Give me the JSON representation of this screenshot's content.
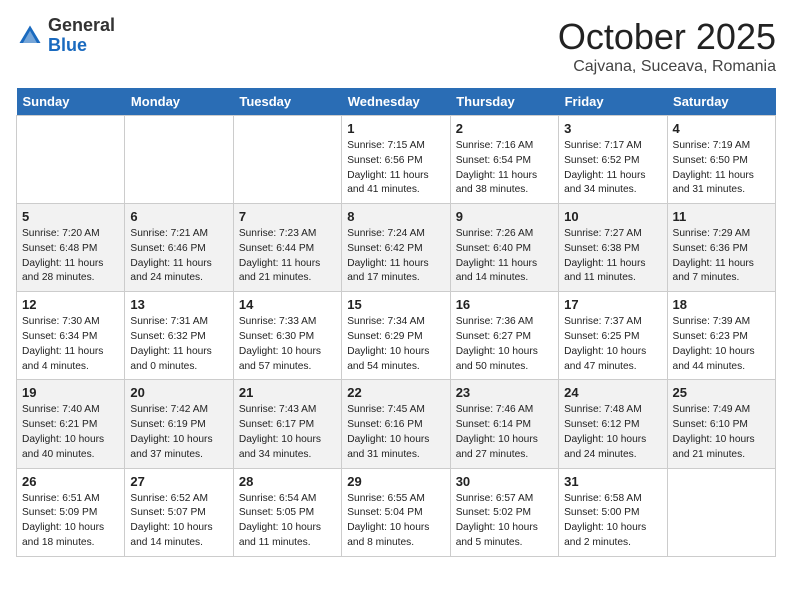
{
  "header": {
    "logo_general": "General",
    "logo_blue": "Blue",
    "month": "October 2025",
    "location": "Cajvana, Suceava, Romania"
  },
  "days_of_week": [
    "Sunday",
    "Monday",
    "Tuesday",
    "Wednesday",
    "Thursday",
    "Friday",
    "Saturday"
  ],
  "weeks": [
    [
      {
        "day": "",
        "info": ""
      },
      {
        "day": "",
        "info": ""
      },
      {
        "day": "",
        "info": ""
      },
      {
        "day": "1",
        "info": "Sunrise: 7:15 AM\nSunset: 6:56 PM\nDaylight: 11 hours\nand 41 minutes."
      },
      {
        "day": "2",
        "info": "Sunrise: 7:16 AM\nSunset: 6:54 PM\nDaylight: 11 hours\nand 38 minutes."
      },
      {
        "day": "3",
        "info": "Sunrise: 7:17 AM\nSunset: 6:52 PM\nDaylight: 11 hours\nand 34 minutes."
      },
      {
        "day": "4",
        "info": "Sunrise: 7:19 AM\nSunset: 6:50 PM\nDaylight: 11 hours\nand 31 minutes."
      }
    ],
    [
      {
        "day": "5",
        "info": "Sunrise: 7:20 AM\nSunset: 6:48 PM\nDaylight: 11 hours\nand 28 minutes."
      },
      {
        "day": "6",
        "info": "Sunrise: 7:21 AM\nSunset: 6:46 PM\nDaylight: 11 hours\nand 24 minutes."
      },
      {
        "day": "7",
        "info": "Sunrise: 7:23 AM\nSunset: 6:44 PM\nDaylight: 11 hours\nand 21 minutes."
      },
      {
        "day": "8",
        "info": "Sunrise: 7:24 AM\nSunset: 6:42 PM\nDaylight: 11 hours\nand 17 minutes."
      },
      {
        "day": "9",
        "info": "Sunrise: 7:26 AM\nSunset: 6:40 PM\nDaylight: 11 hours\nand 14 minutes."
      },
      {
        "day": "10",
        "info": "Sunrise: 7:27 AM\nSunset: 6:38 PM\nDaylight: 11 hours\nand 11 minutes."
      },
      {
        "day": "11",
        "info": "Sunrise: 7:29 AM\nSunset: 6:36 PM\nDaylight: 11 hours\nand 7 minutes."
      }
    ],
    [
      {
        "day": "12",
        "info": "Sunrise: 7:30 AM\nSunset: 6:34 PM\nDaylight: 11 hours\nand 4 minutes."
      },
      {
        "day": "13",
        "info": "Sunrise: 7:31 AM\nSunset: 6:32 PM\nDaylight: 11 hours\nand 0 minutes."
      },
      {
        "day": "14",
        "info": "Sunrise: 7:33 AM\nSunset: 6:30 PM\nDaylight: 10 hours\nand 57 minutes."
      },
      {
        "day": "15",
        "info": "Sunrise: 7:34 AM\nSunset: 6:29 PM\nDaylight: 10 hours\nand 54 minutes."
      },
      {
        "day": "16",
        "info": "Sunrise: 7:36 AM\nSunset: 6:27 PM\nDaylight: 10 hours\nand 50 minutes."
      },
      {
        "day": "17",
        "info": "Sunrise: 7:37 AM\nSunset: 6:25 PM\nDaylight: 10 hours\nand 47 minutes."
      },
      {
        "day": "18",
        "info": "Sunrise: 7:39 AM\nSunset: 6:23 PM\nDaylight: 10 hours\nand 44 minutes."
      }
    ],
    [
      {
        "day": "19",
        "info": "Sunrise: 7:40 AM\nSunset: 6:21 PM\nDaylight: 10 hours\nand 40 minutes."
      },
      {
        "day": "20",
        "info": "Sunrise: 7:42 AM\nSunset: 6:19 PM\nDaylight: 10 hours\nand 37 minutes."
      },
      {
        "day": "21",
        "info": "Sunrise: 7:43 AM\nSunset: 6:17 PM\nDaylight: 10 hours\nand 34 minutes."
      },
      {
        "day": "22",
        "info": "Sunrise: 7:45 AM\nSunset: 6:16 PM\nDaylight: 10 hours\nand 31 minutes."
      },
      {
        "day": "23",
        "info": "Sunrise: 7:46 AM\nSunset: 6:14 PM\nDaylight: 10 hours\nand 27 minutes."
      },
      {
        "day": "24",
        "info": "Sunrise: 7:48 AM\nSunset: 6:12 PM\nDaylight: 10 hours\nand 24 minutes."
      },
      {
        "day": "25",
        "info": "Sunrise: 7:49 AM\nSunset: 6:10 PM\nDaylight: 10 hours\nand 21 minutes."
      }
    ],
    [
      {
        "day": "26",
        "info": "Sunrise: 6:51 AM\nSunset: 5:09 PM\nDaylight: 10 hours\nand 18 minutes."
      },
      {
        "day": "27",
        "info": "Sunrise: 6:52 AM\nSunset: 5:07 PM\nDaylight: 10 hours\nand 14 minutes."
      },
      {
        "day": "28",
        "info": "Sunrise: 6:54 AM\nSunset: 5:05 PM\nDaylight: 10 hours\nand 11 minutes."
      },
      {
        "day": "29",
        "info": "Sunrise: 6:55 AM\nSunset: 5:04 PM\nDaylight: 10 hours\nand 8 minutes."
      },
      {
        "day": "30",
        "info": "Sunrise: 6:57 AM\nSunset: 5:02 PM\nDaylight: 10 hours\nand 5 minutes."
      },
      {
        "day": "31",
        "info": "Sunrise: 6:58 AM\nSunset: 5:00 PM\nDaylight: 10 hours\nand 2 minutes."
      },
      {
        "day": "",
        "info": ""
      }
    ]
  ]
}
